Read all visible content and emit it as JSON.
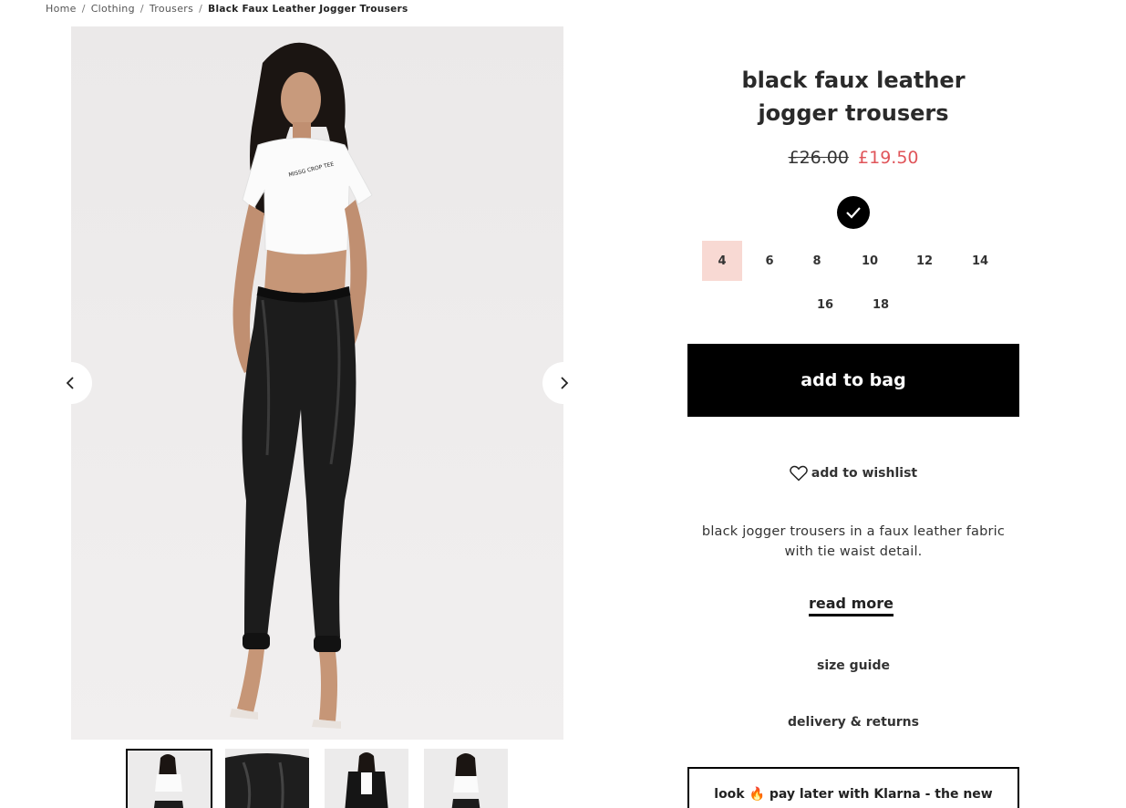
{
  "breadcrumb": {
    "items": [
      "Home",
      "Clothing",
      "Trousers"
    ],
    "current": "Black Faux Leather Jogger Trousers",
    "separator": "/"
  },
  "product": {
    "title": "black faux leather jogger trousers",
    "price_original": "£26.00",
    "price_sale": "£19.50",
    "color_selected": "black",
    "sizes": [
      "4",
      "6",
      "8",
      "10",
      "12",
      "14",
      "16",
      "18"
    ],
    "size_selected": "4",
    "add_to_bag_label": "add to bag",
    "wishlist_label": "add to wishlist",
    "description": "black jogger trousers in a faux leather fabric with tie waist detail.",
    "read_more_label": "read more",
    "size_guide_label": "size guide",
    "delivery_label": "delivery & returns",
    "klarna_text": "look",
    "klarna_emoji": "🔥",
    "klarna_text_2": "pay later with Klarna - the new"
  },
  "gallery": {
    "tee_text": "MISSG CROP TEE",
    "thumbnail_count": 4,
    "active_index": 0
  },
  "colors": {
    "accent_sale": "#e0555a",
    "selected_size_bg": "#f8d9d3",
    "primary_button": "#000000"
  }
}
